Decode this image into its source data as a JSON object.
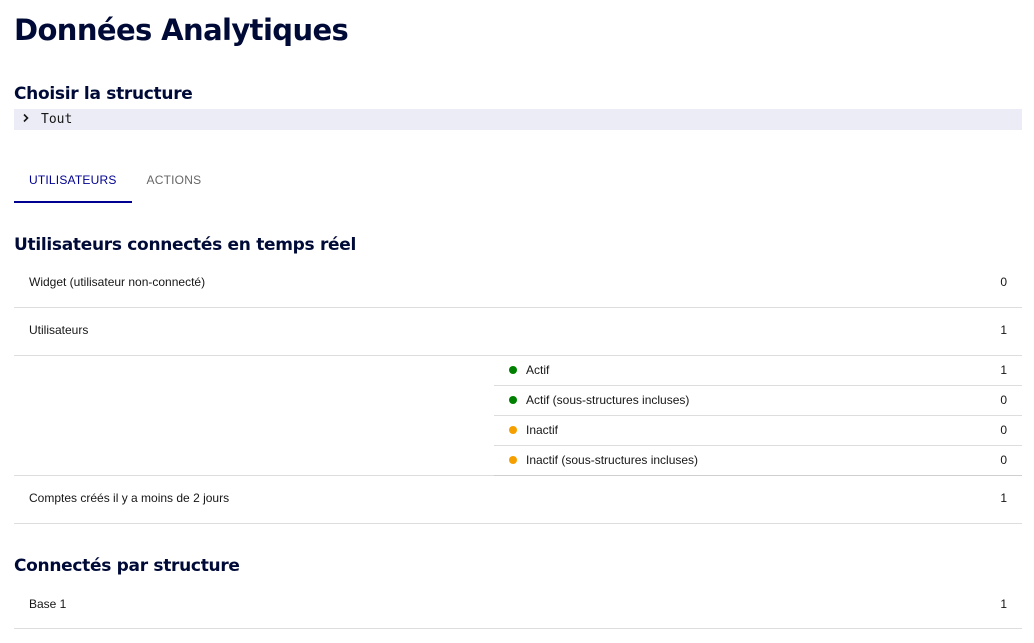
{
  "page": {
    "title": "Données Analytiques"
  },
  "structure": {
    "heading": "Choisir la structure",
    "selected": "Tout"
  },
  "tabs": [
    {
      "label": "UTILISATEURS",
      "active": true
    },
    {
      "label": "ACTIONS",
      "active": false
    }
  ],
  "realtime": {
    "heading": "Utilisateurs connectés en temps réel",
    "widget": {
      "label": "Widget (utilisateur non-connecté)",
      "value": "0"
    },
    "users": {
      "label": "Utilisateurs",
      "value": "1"
    },
    "breakdown": [
      {
        "label": "Actif",
        "value": "1",
        "status": "active"
      },
      {
        "label": "Actif (sous-structures incluses)",
        "value": "0",
        "status": "active"
      },
      {
        "label": "Inactif",
        "value": "0",
        "status": "inactive"
      },
      {
        "label": "Inactif (sous-structures incluses)",
        "value": "0",
        "status": "inactive"
      }
    ],
    "recent_accounts": {
      "label": "Comptes créés il y a moins de 2 jours",
      "value": "1"
    }
  },
  "by_structure": {
    "heading": "Connectés par structure",
    "rows": [
      {
        "label": "Base 1",
        "value": "1"
      }
    ]
  },
  "colors": {
    "active_dot": "#008000",
    "inactive_dot": "#f5a000",
    "accent": "#000091",
    "heading": "#000a37"
  }
}
